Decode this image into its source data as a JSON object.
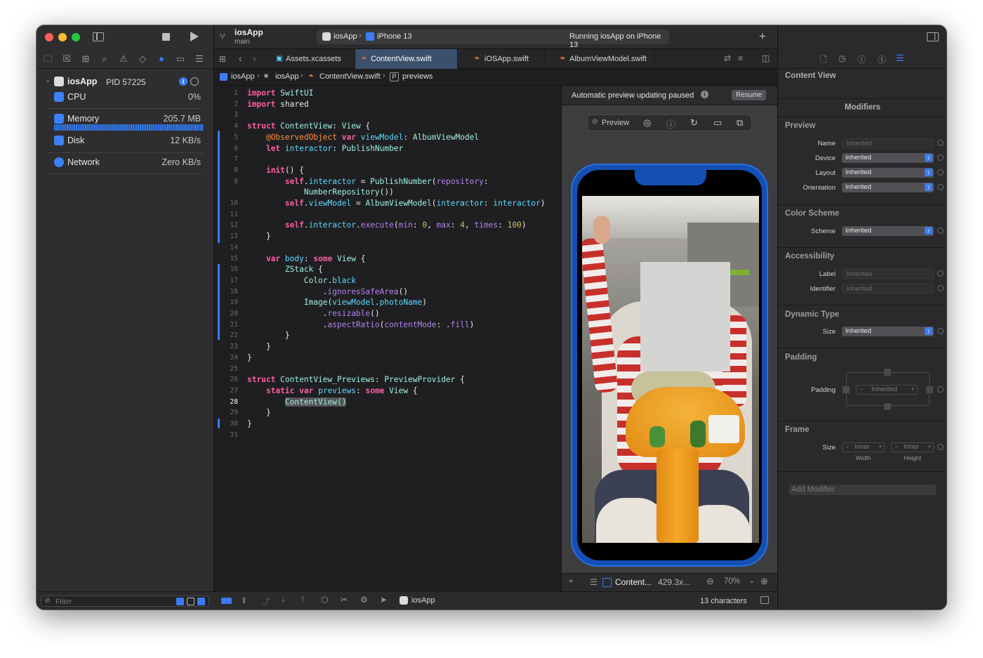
{
  "window": {
    "scheme_name": "iosApp",
    "branch": "main",
    "run_destination": {
      "scheme": "iosApp",
      "device": "iPhone 13"
    },
    "activity_status": "Running iosApp on iPhone 13"
  },
  "debug_navigator": {
    "process": {
      "name": "iosApp",
      "pid_label": "PID 57225"
    },
    "gauges": [
      {
        "label": "CPU",
        "value": "0%"
      },
      {
        "label": "Memory",
        "value": "205.7 MB"
      },
      {
        "label": "Disk",
        "value": "12 KB/s"
      },
      {
        "label": "Network",
        "value": "Zero KB/s"
      }
    ],
    "filter_placeholder": "Filter"
  },
  "tabs": [
    {
      "label": "Assets.xcassets",
      "active": false
    },
    {
      "label": "ContentView.swift",
      "active": true
    },
    {
      "label": "iOSApp.swift",
      "active": false
    },
    {
      "label": "AlbumViewModel.swift",
      "active": false
    }
  ],
  "jump_bar": [
    "iosApp",
    "iosApp",
    "ContentView.swift",
    "previews"
  ],
  "jump_bar_symbol": "P",
  "code_lines": [
    "import SwiftUI",
    "import shared",
    "",
    "struct ContentView: View {",
    "    @ObservedObject var viewModel: AlbumViewModel",
    "    let interactor: PublishNumber",
    "",
    "    init() {",
    "        self.interactor = PublishNumber(repository:",
    "            NumberRepository())",
    "        self.viewModel = AlbumViewModel(interactor: interactor)",
    "",
    "        self.interactor.execute(min: 0, max: 4, times: 100)",
    "    }",
    "",
    "    var body: some View {",
    "        ZStack {",
    "            Color.black",
    "                .ignoresSafeArea()",
    "            Image(viewModel.photoName)",
    "                .resizable()",
    "                .aspectRatio(contentMode: .fill)",
    "        }",
    "    }",
    "}",
    "",
    "struct ContentView_Previews: PreviewProvider {",
    "    static var previews: some View {",
    "        ContentView()",
    "    }",
    "}",
    ""
  ],
  "line_numbers": [
    "1",
    "2",
    "3",
    "4",
    "5",
    "6",
    "7",
    "8",
    "9",
    "",
    "10",
    "11",
    "12",
    "13",
    "14",
    "15",
    "16",
    "17",
    "18",
    "19",
    "20",
    "21",
    "22",
    "23",
    "24",
    "25",
    "26",
    "27",
    "28",
    "29",
    "30",
    "31"
  ],
  "current_line": "28",
  "canvas": {
    "paused_message": "Automatic preview updating paused",
    "resume_label": "Resume",
    "preview_label": "Preview",
    "bottom_title": "Content...",
    "bottom_size": "429.3x...",
    "zoom": "70%"
  },
  "debug_bar": {
    "process_name": "iosApp",
    "selection_count": "13 characters"
  },
  "inspector": {
    "title": "Content View",
    "modifiers_header": "Modifiers",
    "sections": {
      "preview": "Preview",
      "color_scheme": "Color Scheme",
      "accessibility": "Accessibility",
      "dynamic_type": "Dynamic Type",
      "padding": "Padding",
      "frame": "Frame"
    },
    "fields": {
      "name_label": "Name",
      "name_value": "Inherited",
      "device_label": "Device",
      "device_value": "Inherited",
      "layout_label": "Layout",
      "layout_value": "Inherited",
      "orientation_label": "Orientation",
      "orientation_value": "Inherited",
      "scheme_label": "Scheme",
      "scheme_value": "Inherited",
      "a11y_label_label": "Label",
      "a11y_label_value": "Inherited",
      "identifier_label": "Identifier",
      "identifier_value": "Inherited",
      "size_label": "Size",
      "size_value": "Inherited",
      "padding_label": "Padding",
      "padding_value": "Inherited",
      "frame_size_label": "Size",
      "frame_width_value": "Inher",
      "frame_height_value": "Inher",
      "width_caption": "Width",
      "height_caption": "Height",
      "stepper_minus": "-",
      "stepper_plus": "+"
    },
    "add_modifier_placeholder": "Add Modifier"
  },
  "colors": {
    "accent": "#3b7cf6",
    "swift_file": "#f0733a",
    "keyword": "#fc5fa3"
  }
}
